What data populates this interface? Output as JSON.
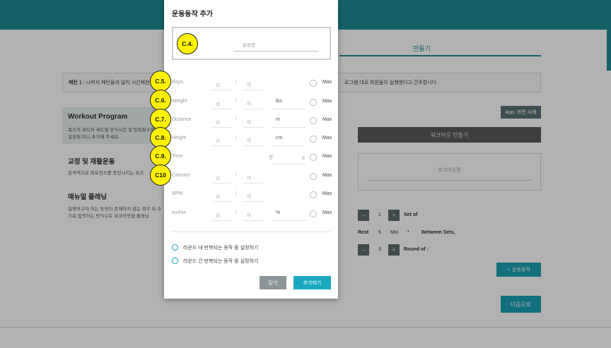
{
  "background": {
    "tab_label": "만들기",
    "notice": {
      "label": "패턴 1 :",
      "text": "나머지 패턴들과 달리 시간제한",
      "text_right": "로그램 대로 회원들이 실행했다고 간주합니다."
    },
    "workout_program": {
      "title": "Workout Program",
      "desc": "복수의 세트와 세트별 휴식시간 및 반복횟수를 설정해 미니 추가해 주세요."
    },
    "rehab": {
      "title": "교정 및 재활운동",
      "desc": "본격적으로 퍼포먼스를 증진시키는 워크"
    },
    "manual": {
      "title": "매뉴얼 플래닝",
      "desc": "실행하고자 하는 동작이 존재하지 않는 경우 뒤 수기로 입력하는 방식으로 워크아웃을 플래닝"
    },
    "app_button": "App. 화면 사례",
    "make_button": "워크아웃 만들기",
    "workout_name_placeholder": "워크아웃명",
    "set_value": "1",
    "set_label": "Set of",
    "rest_label": "Rest",
    "rest_value": "5",
    "rest_unit": "Min",
    "rest_separator": "*",
    "between_sets_label": "Between Sets,",
    "round_value": "3",
    "round_label": "Round of :",
    "minus_symbol": "−",
    "plus_symbol": "+",
    "add_motion_button": "운동동작",
    "add_motion_plus": "+",
    "next_button": "다음으로"
  },
  "modal": {
    "title": "운동동작 추가",
    "search_placeholder": "운동명",
    "rows": [
      {
        "label": "Reps",
        "in1": "남",
        "slash": "/",
        "in2": "여",
        "unit": "",
        "max": "Max"
      },
      {
        "label": "Weight",
        "in1": "남",
        "slash": "/",
        "in2": "여",
        "unit": "lbs",
        "max": "Max"
      },
      {
        "label": "Distance",
        "in1": "남",
        "slash": "/",
        "in2": "여",
        "unit": "m",
        "max": "Max"
      },
      {
        "label": "Height",
        "in1": "남",
        "slash": "/",
        "in2": "여",
        "unit": "cm",
        "max": "Max"
      },
      {
        "label": "Time",
        "in1": "",
        "slash": "",
        "in2": "",
        "unit": "분",
        "unit2": "초",
        "max": "Max"
      },
      {
        "label": "Calories",
        "in1": "남",
        "slash": "/",
        "in2": "여",
        "unit": "",
        "max": "Max"
      },
      {
        "label": "RPM",
        "in1": "남",
        "slash": "/",
        "in2": "여",
        "unit": "",
        "max": "Max"
      },
      {
        "label": "Incline",
        "in1": "남",
        "slash": "/",
        "in2": "여",
        "unit": "%",
        "max": "Max"
      }
    ],
    "option_within_round": "라운드 내 반복되는 동작 를 설정하기",
    "option_between_rounds": "라운드 간 반복되는 동작 를 설정하기",
    "close_button": "닫기",
    "add_button": "추가하기"
  },
  "callouts": [
    "C.4.",
    "C.5.",
    "C.6.",
    "C.7.",
    "C.8.",
    "C.9.",
    "C10"
  ],
  "colors": {
    "brand": "#1f8c96",
    "accent": "#1aa8bf",
    "callout": "#fff200"
  }
}
